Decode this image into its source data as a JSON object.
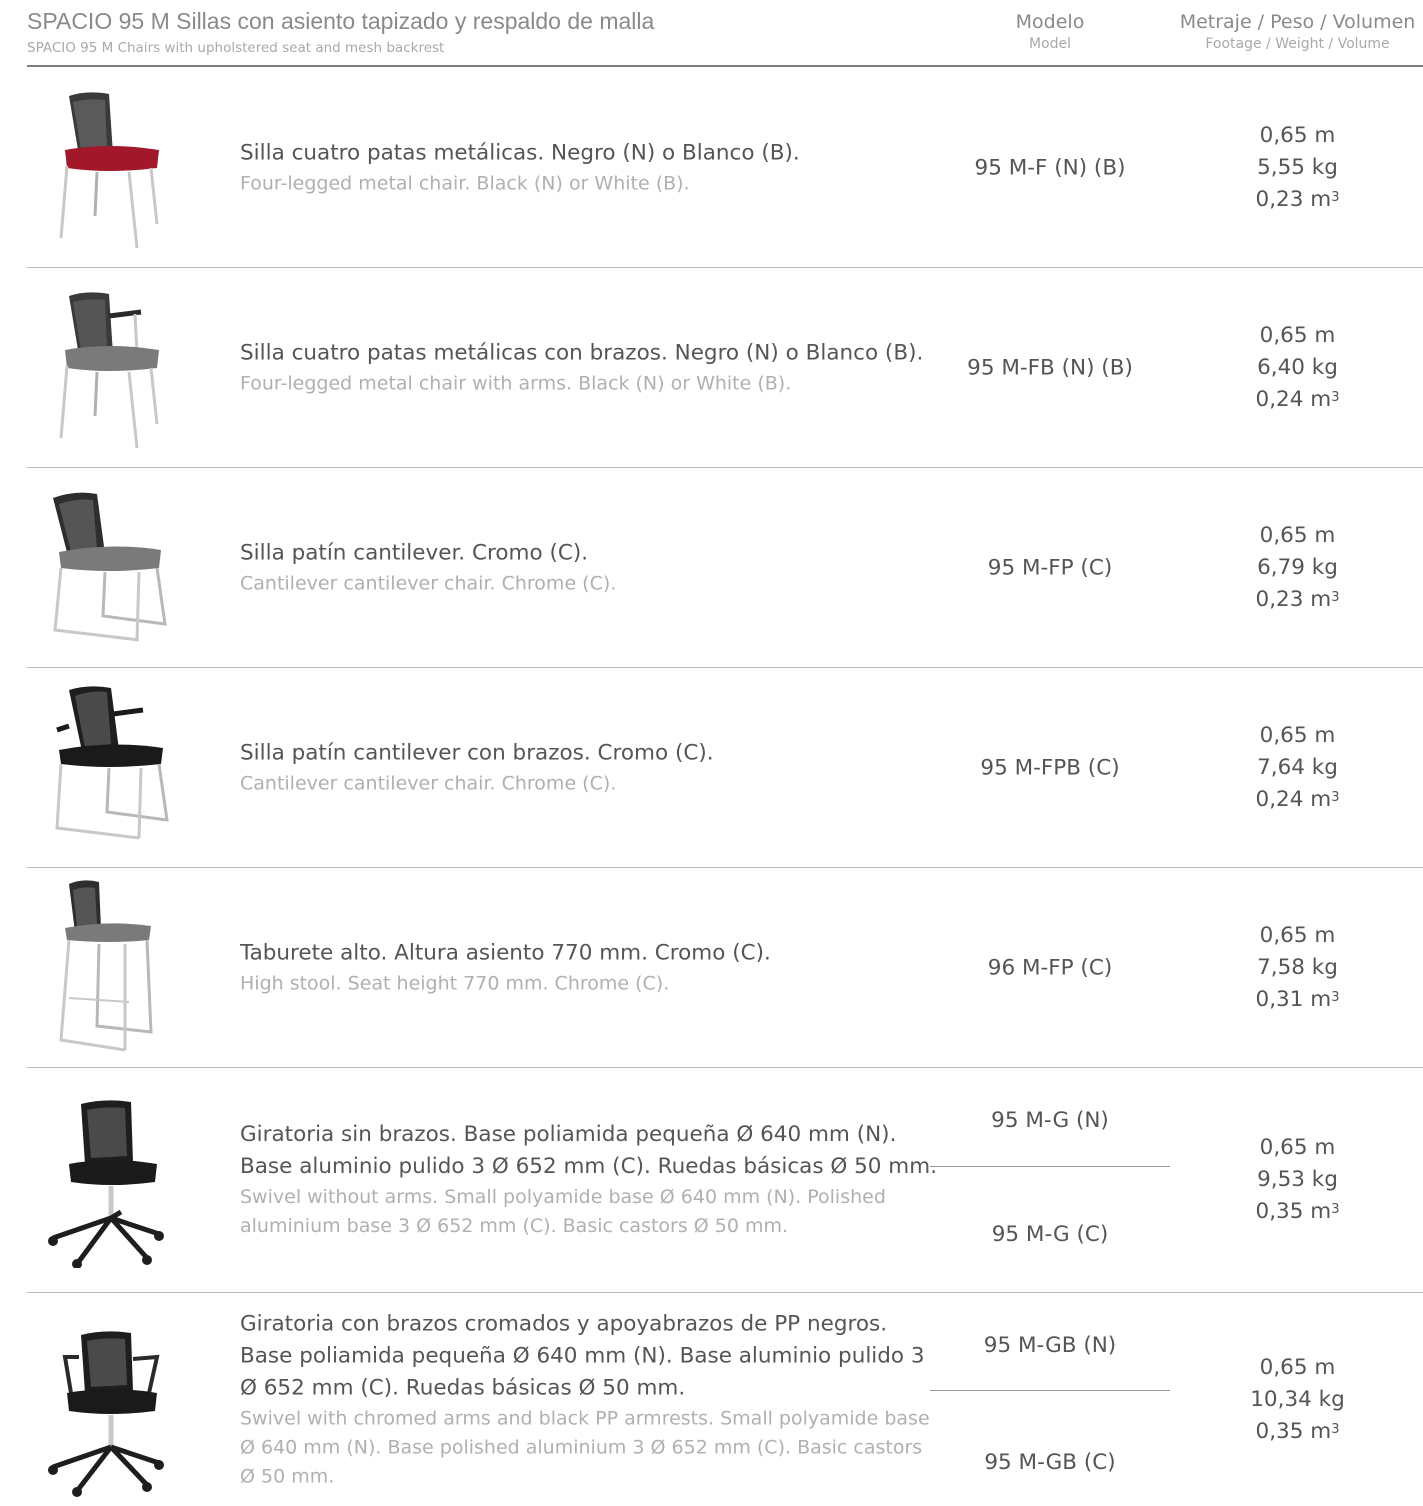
{
  "header": {
    "title": "SPACIO 95 M Sillas con asiento tapizado y respaldo de malla",
    "subtitle": "SPACIO 95 M Chairs with upholstered seat and mesh backrest",
    "model_es": "Modelo",
    "model_en": "Model",
    "metrics_es": "Metraje / Peso / Volumen",
    "metrics_en": "Footage / Weight / Volume"
  },
  "rows": [
    {
      "image": "four-leg-chair-red-seat-icon",
      "desc_es": "Silla cuatro patas metálicas. Negro (N) o Blanco (B).",
      "desc_en": "Four-legged metal chair. Black (N) or White (B).",
      "models": [
        "95 M-F (N) (B)"
      ],
      "footage": "0,65 m",
      "weight": "5,55 kg",
      "volume": "0,23 m",
      "volume_exp": "3"
    },
    {
      "image": "four-leg-chair-arms-icon",
      "desc_es": "Silla cuatro patas metálicas con brazos. Negro (N) o Blanco (B).",
      "desc_en": "Four-legged metal chair with arms. Black (N) or White (B).",
      "models": [
        "95 M-FB (N) (B)"
      ],
      "footage": "0,65 m",
      "weight": "6,40 kg",
      "volume": "0,24 m",
      "volume_exp": "3"
    },
    {
      "image": "cantilever-chair-icon",
      "desc_es": "Silla patín cantilever. Cromo (C).",
      "desc_en": "Cantilever cantilever chair. Chrome (C).",
      "models": [
        "95 M-FP (C)"
      ],
      "footage": "0,65 m",
      "weight": "6,79 kg",
      "volume": "0,23 m",
      "volume_exp": "3"
    },
    {
      "image": "cantilever-chair-arms-icon",
      "desc_es": "Silla patín cantilever con brazos. Cromo (C).",
      "desc_en": "Cantilever cantilever chair. Chrome (C).",
      "models": [
        "95 M-FPB (C)"
      ],
      "footage": "0,65 m",
      "weight": "7,64 kg",
      "volume": "0,24 m",
      "volume_exp": "3"
    },
    {
      "image": "high-stool-icon",
      "desc_es": "Taburete alto. Altura asiento 770 mm. Cromo (C).",
      "desc_en": "High stool. Seat height 770 mm. Chrome (C).",
      "models": [
        "96 M-FP (C)"
      ],
      "footage": "0,65 m",
      "weight": "7,58 kg",
      "volume": "0,31 m",
      "volume_exp": "3"
    },
    {
      "image": "swivel-chair-icon",
      "desc_es": "Giratoria sin brazos. Base poliamida pequeña Ø 640 mm (N). Base aluminio pulido 3 Ø 652 mm (C). Ruedas básicas Ø 50 mm.",
      "desc_en": "Swivel without arms. Small polyamide base Ø 640 mm (N). Polished aluminium base 3 Ø 652 mm (C). Basic castors Ø 50 mm.",
      "models": [
        "95 M-G (N)",
        "95 M-G (C)"
      ],
      "footage": "0,65 m",
      "weight": "9,53 kg",
      "volume": "0,35 m",
      "volume_exp": "3"
    },
    {
      "image": "swivel-chair-arms-icon",
      "desc_es": "Giratoria con brazos cromados y apoyabrazos de PP negros. Base poliamida pequeña Ø 640 mm (N). Base aluminio pulido 3 Ø 652 mm (C). Ruedas básicas Ø 50 mm.",
      "desc_en": "Swivel with chromed arms and black PP armrests. Small polyamide base Ø 640 mm (N). Base polished aluminium 3 Ø 652 mm (C). Basic castors Ø 50 mm.",
      "models": [
        "95 M-GB (N)",
        "95 M-GB (C)"
      ],
      "footage": "0,65 m",
      "weight": "10,34 kg",
      "volume": "0,35 m",
      "volume_exp": "3"
    }
  ],
  "colors": {
    "seat_red": "#a3172a",
    "seat_grey": "#7a7a7a",
    "seat_black": "#1a1a1a",
    "frame_chrome": "#c8c8c8"
  }
}
